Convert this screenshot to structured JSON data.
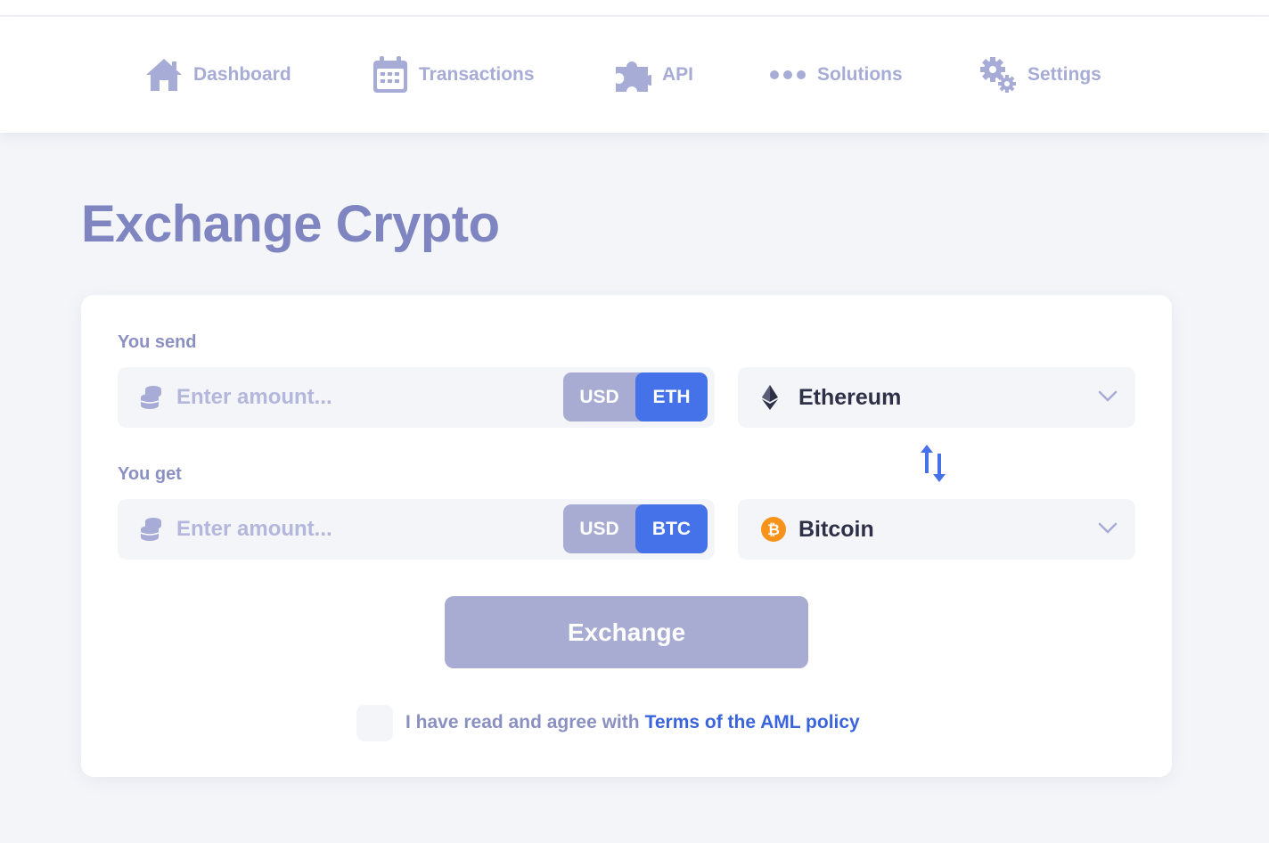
{
  "nav": {
    "items": [
      {
        "label": "Dashboard",
        "icon": "home-icon"
      },
      {
        "label": "Transactions",
        "icon": "calendar-icon"
      },
      {
        "label": "API",
        "icon": "puzzle-icon"
      },
      {
        "label": "Solutions",
        "icon": "dots-icon"
      },
      {
        "label": "Settings",
        "icon": "gears-icon"
      }
    ]
  },
  "page": {
    "title": "Exchange Crypto"
  },
  "send": {
    "label": "You send",
    "placeholder": "Enter amount...",
    "currency_fiat": "USD",
    "currency_crypto": "ETH",
    "selected_coin": "Ethereum"
  },
  "get": {
    "label": "You get",
    "placeholder": "Enter amount...",
    "currency_fiat": "USD",
    "currency_crypto": "BTC",
    "selected_coin": "Bitcoin"
  },
  "exchange_button": "Exchange",
  "agreement": {
    "text": "I have read and agree with",
    "link": "Terms of the AML policy"
  },
  "colors": {
    "accent": "#4672e9",
    "muted": "#a8acd2",
    "title": "#7e85c0",
    "bitcoin": "#f7931a"
  }
}
